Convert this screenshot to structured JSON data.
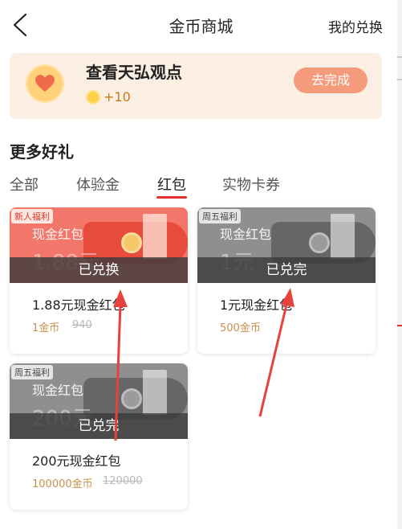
{
  "header": {
    "title": "金币商城",
    "my_exchange_label": "我的兑换"
  },
  "task": {
    "title": "查看天弘观点",
    "reward": "+10",
    "button_label": "去完成"
  },
  "section": {
    "title": "更多好礼"
  },
  "tabs": [
    {
      "label": "全部",
      "active": false
    },
    {
      "label": "体验金",
      "active": false
    },
    {
      "label": "红包",
      "active": true
    },
    {
      "label": "实物卡券",
      "active": false
    }
  ],
  "gifts": [
    {
      "tag": "新人福利",
      "thumb_label": "现金红包",
      "thumb_amount": "1.88元",
      "status": "已兑换",
      "name": "1.88元现金红包",
      "price": "1金币",
      "original_price": "940",
      "theme": "red"
    },
    {
      "tag": "周五福利",
      "thumb_label": "现金红包",
      "thumb_amount": "1元",
      "status": "已兑完",
      "name": "1元现金红包",
      "price": "500金币",
      "original_price": "",
      "theme": "gray"
    },
    {
      "tag": "周五福利",
      "thumb_label": "现金红包",
      "thumb_amount": "200元",
      "status": "已兑完",
      "name": "200元现金红包",
      "price": "100000金币",
      "original_price": "120000",
      "theme": "gray"
    }
  ],
  "colors": {
    "accent_red": "#e2322b",
    "banner_bg": "#fbeee3",
    "button_bg": "#f59a7a",
    "price_gold": "#c9904a",
    "annotation_arrow": "#e8433a"
  }
}
